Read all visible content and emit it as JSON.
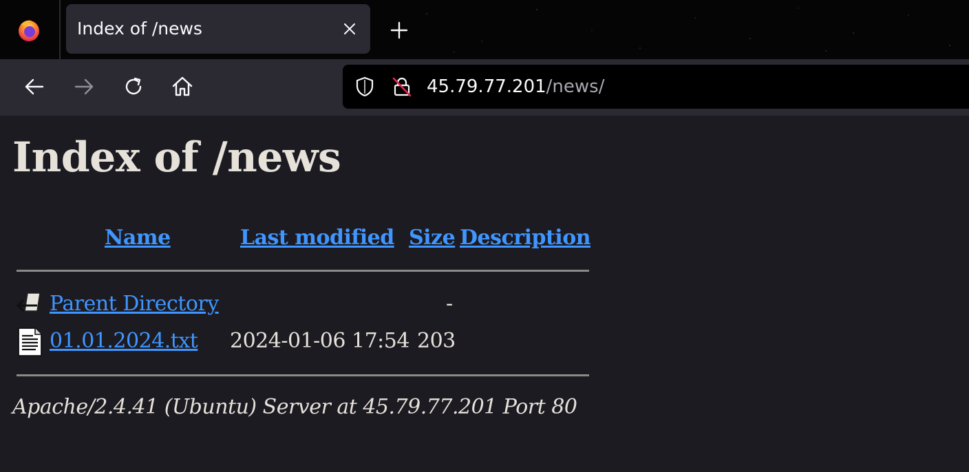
{
  "browser": {
    "tab": {
      "title": "Index of /news"
    },
    "url": {
      "host": "45.79.77.201",
      "path": "/news/"
    },
    "icons": {
      "logo": "firefox-logo",
      "tab_close": "close-icon",
      "new_tab": "plus-icon",
      "back": "arrow-left-icon",
      "forward": "arrow-right-icon",
      "reload": "reload-icon",
      "home": "home-icon",
      "tracking": "shield-icon",
      "insecure": "lock-slash-icon"
    },
    "colors": {
      "tabstrip": "#050505",
      "toolbar": "#2b2a33",
      "urlbar": "#000000"
    }
  },
  "page": {
    "heading": "Index of /news",
    "columns": {
      "name": "Name",
      "last_modified": "Last modified",
      "size": "Size",
      "description": "Description"
    },
    "rows": [
      {
        "icon": "parent-directory-icon",
        "name": "Parent Directory",
        "last_modified": "",
        "size": "-",
        "description": ""
      },
      {
        "icon": "text-file-icon",
        "name": "01.01.2024.txt",
        "last_modified": "2024-01-06 17:54",
        "size": "203",
        "description": ""
      }
    ],
    "server_signature": "Apache/2.4.41 (Ubuntu) Server at 45.79.77.201 Port 80",
    "colors": {
      "background": "#1c1b22",
      "text": "#e0ddd6",
      "link": "#3f96ff"
    }
  }
}
